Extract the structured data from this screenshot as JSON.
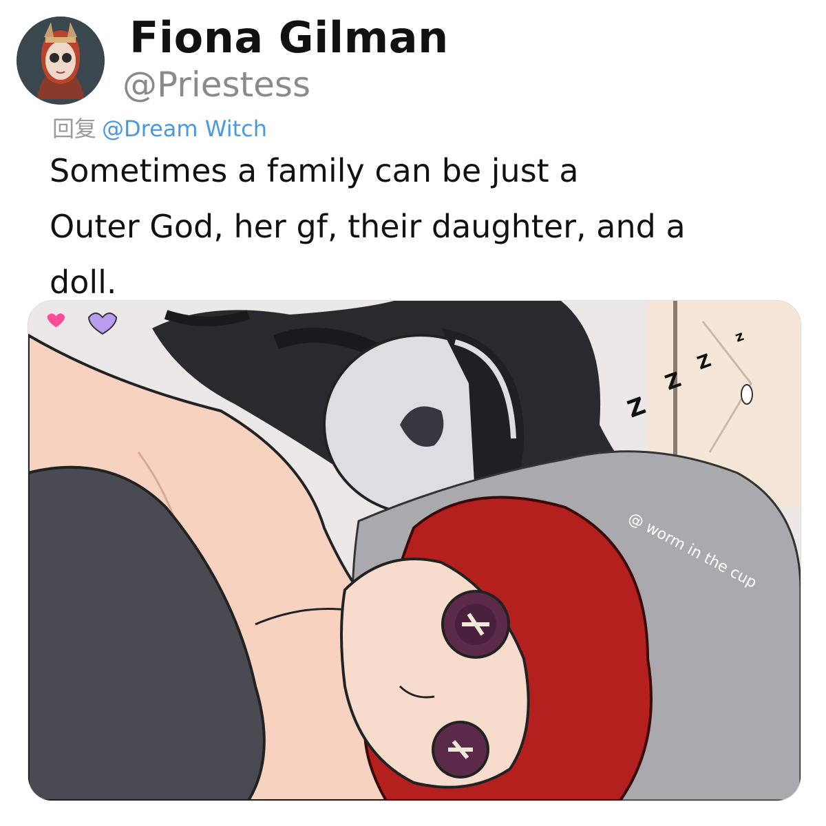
{
  "profile": {
    "display_name": "Fiona Gilman",
    "handle": "@Priestess",
    "avatar_icon": "avatar-icon"
  },
  "reply": {
    "prefix": "回复",
    "mention": "@Dream Witch"
  },
  "tweet": {
    "text": "Sometimes a family can be just a\nOuter God, her gf, their daughter, and a\ndoll."
  },
  "media": {
    "watermark": "@ worm in the cup",
    "sleep_text": "Z z z z"
  },
  "colors": {
    "name": "#111111",
    "handle": "#8a8a8a",
    "mention": "#4a98e0",
    "hair": "#b3201e",
    "skin": "#f7d7c4",
    "blanket": "#4a4a52"
  }
}
